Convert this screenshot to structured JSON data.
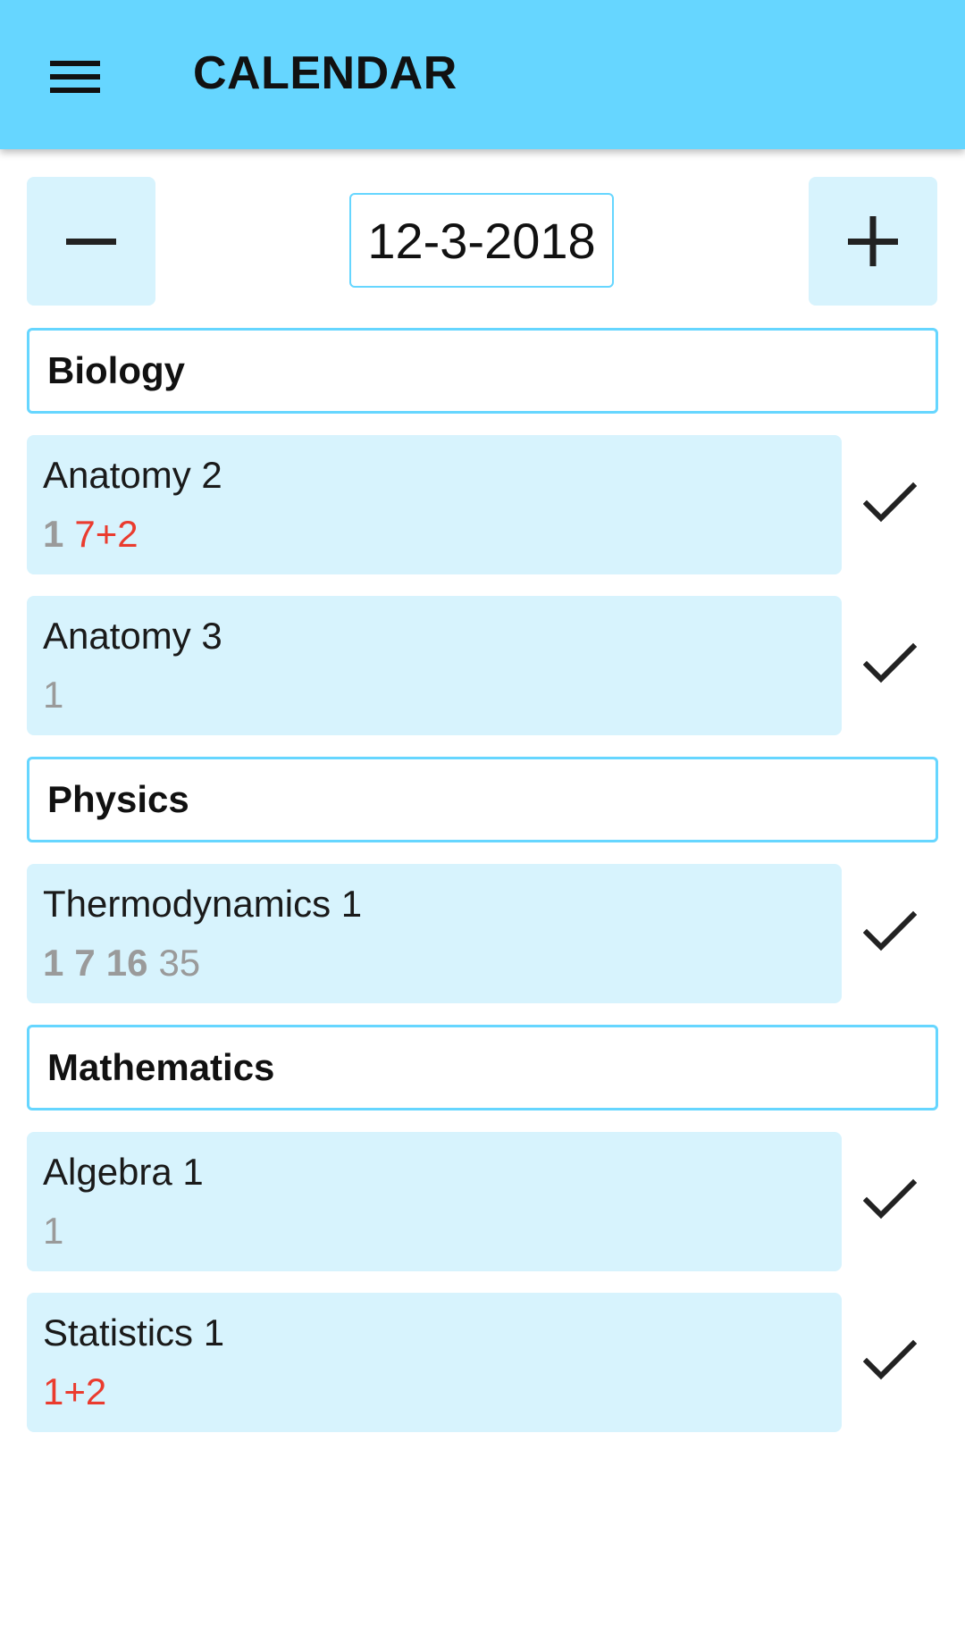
{
  "appbar": {
    "title": "CALENDAR",
    "menu_icon": "menu-icon",
    "color": "#66d6ff"
  },
  "date_nav": {
    "decrement_icon": "minus-icon",
    "increment_icon": "plus-icon",
    "date": "12-3-2018"
  },
  "sections": [
    {
      "name": "Biology",
      "items": [
        {
          "title": "Anatomy 2",
          "tokens": [
            {
              "text": "1",
              "style": "gray-bold"
            },
            {
              "text": "7+2",
              "style": "red"
            }
          ]
        },
        {
          "title": "Anatomy 3",
          "tokens": [
            {
              "text": "1",
              "style": "gray"
            }
          ]
        }
      ]
    },
    {
      "name": "Physics",
      "items": [
        {
          "title": "Thermodynamics 1",
          "tokens": [
            {
              "text": "1",
              "style": "gray-bold"
            },
            {
              "text": "7",
              "style": "gray-bold"
            },
            {
              "text": "16",
              "style": "gray-bold"
            },
            {
              "text": "35",
              "style": "gray"
            }
          ]
        }
      ]
    },
    {
      "name": "Mathematics",
      "items": [
        {
          "title": "Algebra 1",
          "tokens": [
            {
              "text": "1",
              "style": "gray"
            }
          ]
        },
        {
          "title": "Statistics 1",
          "tokens": [
            {
              "text": "1+2",
              "style": "red"
            }
          ]
        }
      ]
    }
  ],
  "colors": {
    "accent": "#66d6ff",
    "item_bg": "#d7f3fd",
    "overdue_red": "#ea3b2e",
    "muted_gray": "#9a9a9a"
  },
  "icons": {
    "item_action": "check-icon"
  }
}
